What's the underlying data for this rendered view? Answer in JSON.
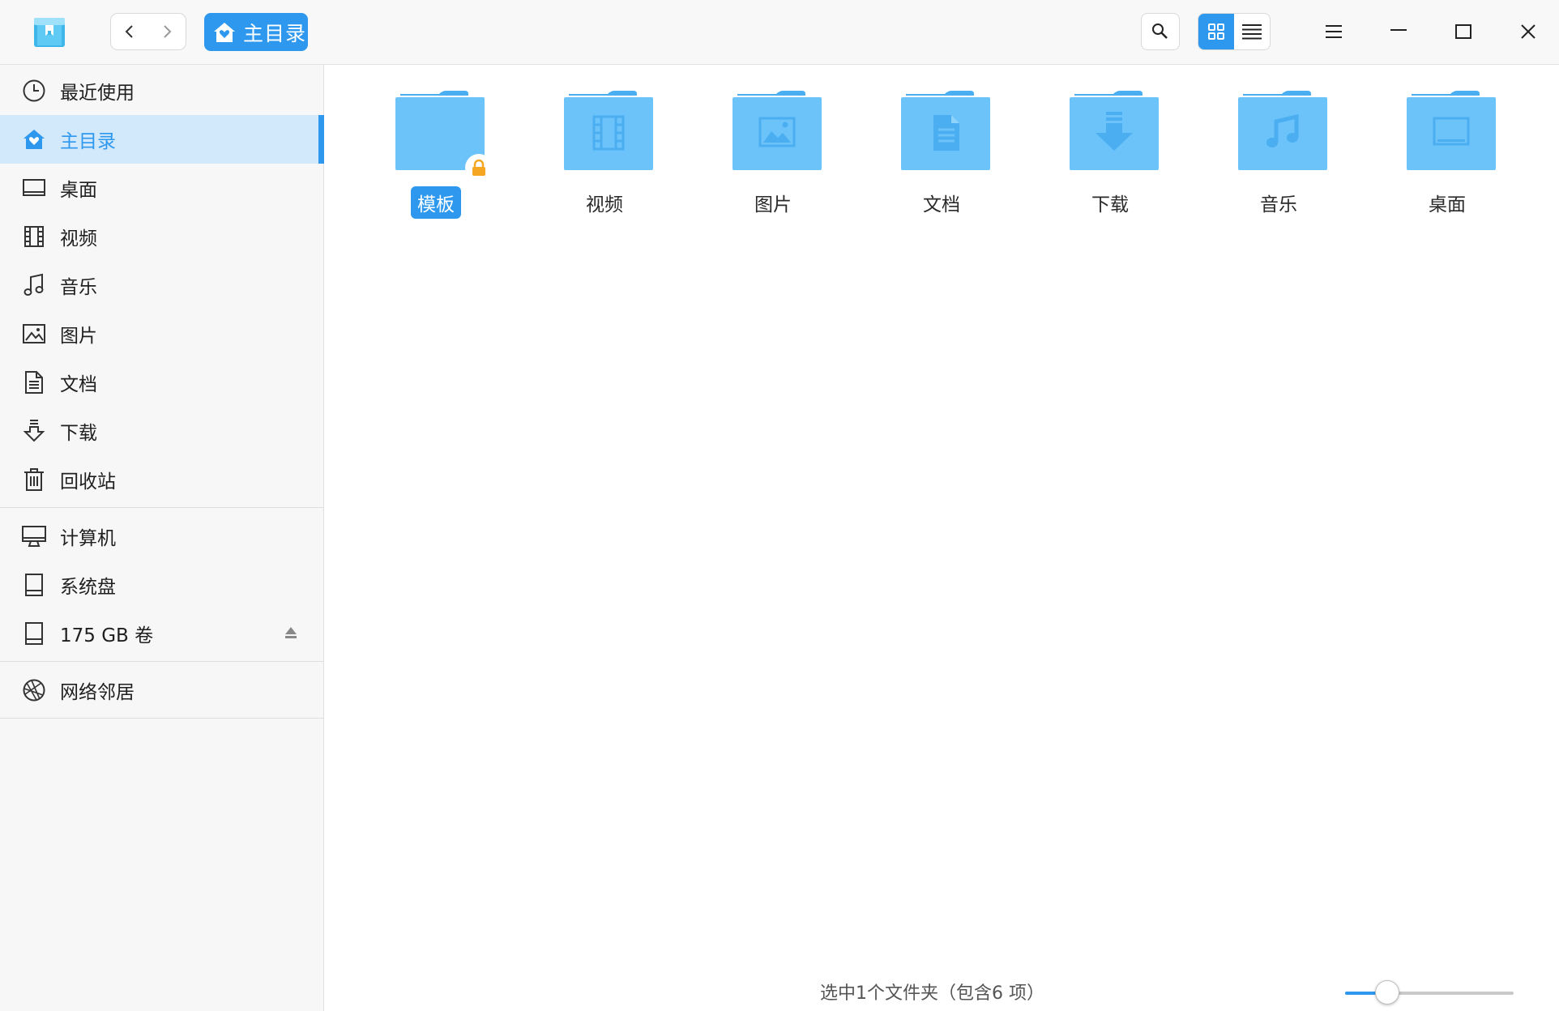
{
  "titlebar": {
    "app_icon": "file-manager-icon",
    "back_icon": "chevron-left-icon",
    "forward_icon": "chevron-right-icon",
    "breadcrumb": {
      "icon": "home-icon",
      "label": "主目录"
    },
    "search_icon": "search-icon",
    "view_modes": [
      "icon-view",
      "list-view"
    ],
    "active_view": "icon-view",
    "window_buttons": [
      "menu-icon",
      "minimize-icon",
      "maximize-icon",
      "close-icon"
    ]
  },
  "sidebar": {
    "items": [
      {
        "label": "最近使用",
        "icon": "clock-icon"
      },
      {
        "label": "主目录",
        "icon": "home-icon",
        "active": true
      },
      {
        "label": "桌面",
        "icon": "desktop-icon"
      },
      {
        "label": "视频",
        "icon": "film-icon"
      },
      {
        "label": "音乐",
        "icon": "music-icon"
      },
      {
        "label": "图片",
        "icon": "image-icon"
      },
      {
        "label": "文档",
        "icon": "document-icon"
      },
      {
        "label": "下载",
        "icon": "download-icon"
      },
      {
        "label": "回收站",
        "icon": "trash-icon"
      }
    ],
    "devices": [
      {
        "label": "计算机",
        "icon": "computer-icon"
      },
      {
        "label": "系统盘",
        "icon": "disk-icon"
      },
      {
        "label": "175 GB 卷",
        "icon": "disk-icon",
        "ejectable": true
      }
    ],
    "network": [
      {
        "label": "网络邻居",
        "icon": "network-icon"
      }
    ]
  },
  "main": {
    "folders": [
      {
        "name": "模板",
        "emblem": "lock-icon",
        "selected": true
      },
      {
        "name": "视频",
        "emblem": "film-icon"
      },
      {
        "name": "图片",
        "emblem": "image-icon"
      },
      {
        "name": "文档",
        "emblem": "document-icon"
      },
      {
        "name": "下载",
        "emblem": "download-icon"
      },
      {
        "name": "音乐",
        "emblem": "music-icon"
      },
      {
        "name": "桌面",
        "emblem": "desktop-icon"
      }
    ],
    "status_text": "选中1个文件夹（包含6 项）",
    "zoom_level": 0.25
  },
  "colors": {
    "accent": "#2d98ee",
    "folder": "#6cc3fa",
    "folder_dark": "#4aaef0",
    "lock": "#f5a623"
  }
}
